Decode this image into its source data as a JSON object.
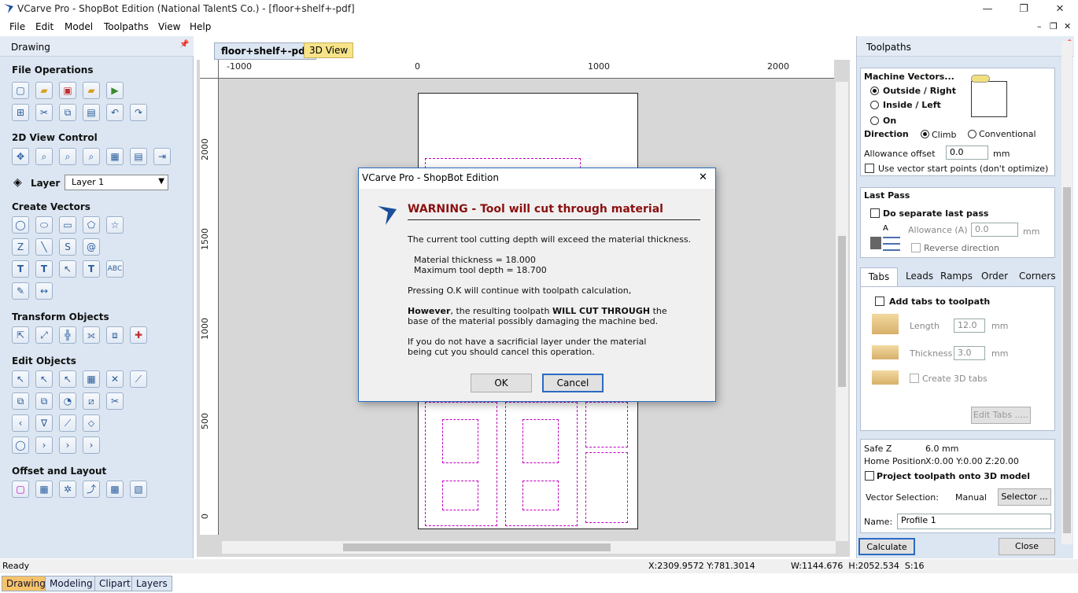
{
  "window": {
    "title": "VCarve Pro - ShopBot Edition (National TalentS Co.) - [floor+shelf+-pdf]",
    "min": "—",
    "restore": "❐",
    "close": "✕"
  },
  "menu": [
    "File",
    "Edit",
    "Model",
    "Toolpaths",
    "View",
    "Help"
  ],
  "mdi_controls": {
    "min": "–",
    "restore": "❐",
    "close": "✕"
  },
  "left_panel": {
    "header": "Drawing",
    "pin": "📌",
    "sections": {
      "file_ops": "File Operations",
      "view_control": "2D View Control",
      "layer_label": "Layer",
      "layer_value": "Layer 1",
      "create_vectors": "Create Vectors",
      "transform": "Transform Objects",
      "edit": "Edit Objects",
      "offset": "Offset and Layout"
    },
    "bottom_tabs": [
      "Drawing",
      "Modeling",
      "Clipart",
      "Layers"
    ]
  },
  "doc_tabs": [
    "floor+shelf+-pdf",
    "3D View"
  ],
  "ruler": {
    "h": [
      "-1000",
      "0",
      "1000",
      "2000"
    ],
    "v": [
      "2000",
      "1500",
      "1000",
      "500",
      "0"
    ]
  },
  "status": {
    "left": "Ready",
    "coords": "X:2309.9572 Y:781.3014",
    "size": "W:1144.676  H:2052.534  S:16"
  },
  "right_panel": {
    "header": "Toolpaths",
    "machine_vectors": "Machine Vectors...",
    "outside": "Outside / Right",
    "inside": "Inside / Left",
    "on": "On",
    "direction": "Direction",
    "climb": "Climb",
    "conventional": "Conventional",
    "allowance_label": "Allowance offset",
    "allowance_value": "0.0",
    "mm": "mm",
    "use_start": "Use vector start points (don't optimize)",
    "last_pass": "Last Pass",
    "do_separate": "Do separate last pass",
    "allowance_a": "Allowance (A)",
    "allowance_a_value": "0.0",
    "reverse": "Reverse direction",
    "tabs": [
      "Tabs",
      "Leads",
      "Ramps",
      "Order",
      "Corners"
    ],
    "add_tabs": "Add tabs to toolpath",
    "length_label": "Length",
    "length_value": "12.0",
    "thickness_label": "Thickness",
    "thickness_value": "3.0",
    "create_3d": "Create 3D tabs",
    "edit_tabs": "Edit Tabs .....",
    "safe_z": "Safe Z",
    "safe_z_value": "6.0 mm",
    "home_label": "Home Position",
    "home_value": "X:0.00 Y:0.00 Z:20.00",
    "project": "Project toolpath onto 3D model",
    "vector_sel": "Vector Selection:",
    "vector_mode": "Manual",
    "selector": "Selector ...",
    "name_label": "Name:",
    "name_value": "Profile 1",
    "calculate": "Calculate",
    "close": "Close"
  },
  "dialog": {
    "title": "VCarve Pro - ShopBot Edition",
    "close": "✕",
    "heading": "WARNING - Tool will cut through material",
    "line1": "The current tool cutting depth will exceed the material thickness.",
    "mat": "Material thickness = 18.000",
    "maxd": "Maximum tool depth = 18.700",
    "line2": "Pressing O.K will continue with toolpath calculation,",
    "however": "However",
    "line3a": ", the resulting toolpath ",
    "will_cut": "WILL CUT THROUGH",
    "line3b": " the",
    "line4": "base of the material possibly damaging the machine bed.",
    "line5": "If you do not have a sacrificial layer under the material",
    "line6": "being cut you should cancel this operation.",
    "ok": "OK",
    "cancel": "Cancel"
  }
}
